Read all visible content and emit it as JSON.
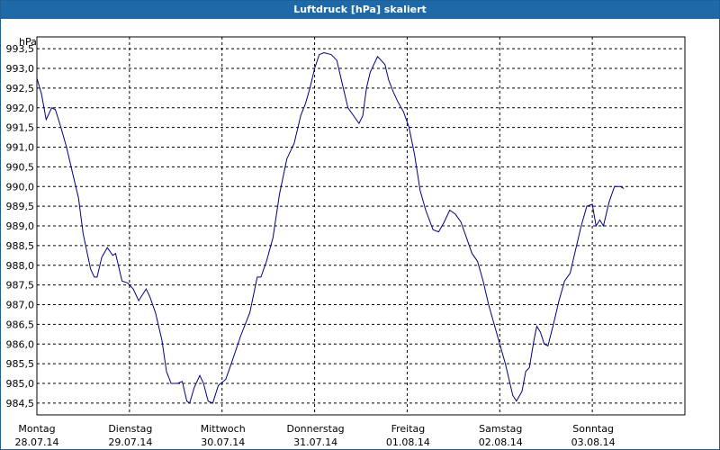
{
  "window": {
    "title": "Luftdruck [hPa] skaliert"
  },
  "chart_data": {
    "type": "line",
    "title": "Luftdruck [hPa] skaliert",
    "ylabel": "hPa",
    "xlim": [
      0,
      7
    ],
    "ylim": [
      984.2,
      993.8
    ],
    "grid": true,
    "line_color": "#000080",
    "y_ticks": [
      "993,5",
      "993,0",
      "992,5",
      "992,0",
      "991,5",
      "991,0",
      "990,5",
      "990,0",
      "989,5",
      "989,0",
      "988,5",
      "988,0",
      "987,5",
      "987,0",
      "986,5",
      "986,0",
      "985,5",
      "985,0",
      "984,5"
    ],
    "y_tick_values": [
      993.5,
      993.0,
      992.5,
      992.0,
      991.5,
      991.0,
      990.5,
      990.0,
      989.5,
      989.0,
      988.5,
      988.0,
      987.5,
      987.0,
      986.5,
      986.0,
      985.5,
      985.0,
      984.5
    ],
    "x_ticks": [
      {
        "day": "Montag",
        "date": "28.07.14"
      },
      {
        "day": "Dienstag",
        "date": "29.07.14"
      },
      {
        "day": "Mittwoch",
        "date": "30.07.14"
      },
      {
        "day": "Donnerstag",
        "date": "31.07.14"
      },
      {
        "day": "Freitag",
        "date": "01.08.14"
      },
      {
        "day": "Samstag",
        "date": "02.08.14"
      },
      {
        "day": "Sonntag",
        "date": "03.08.14"
      }
    ],
    "series": [
      {
        "values": [
          [
            0.0,
            992.75
          ],
          [
            0.05,
            992.35
          ],
          [
            0.1,
            991.7
          ],
          [
            0.16,
            992.0
          ],
          [
            0.2,
            991.95
          ],
          [
            0.26,
            991.5
          ],
          [
            0.32,
            991.0
          ],
          [
            0.4,
            990.2
          ],
          [
            0.45,
            989.7
          ],
          [
            0.5,
            988.8
          ],
          [
            0.58,
            987.9
          ],
          [
            0.62,
            987.7
          ],
          [
            0.65,
            987.7
          ],
          [
            0.7,
            988.2
          ],
          [
            0.76,
            988.45
          ],
          [
            0.82,
            988.25
          ],
          [
            0.85,
            988.3
          ],
          [
            0.92,
            987.6
          ],
          [
            0.98,
            987.55
          ],
          [
            1.04,
            987.4
          ],
          [
            1.1,
            987.1
          ],
          [
            1.18,
            987.4
          ],
          [
            1.22,
            987.2
          ],
          [
            1.28,
            986.8
          ],
          [
            1.35,
            986.1
          ],
          [
            1.4,
            985.3
          ],
          [
            1.45,
            985.0
          ],
          [
            1.52,
            985.0
          ],
          [
            1.57,
            985.05
          ],
          [
            1.62,
            984.55
          ],
          [
            1.65,
            984.5
          ],
          [
            1.7,
            984.9
          ],
          [
            1.76,
            985.2
          ],
          [
            1.8,
            985.0
          ],
          [
            1.85,
            984.55
          ],
          [
            1.9,
            984.5
          ],
          [
            1.96,
            984.95
          ],
          [
            2.04,
            985.1
          ],
          [
            2.1,
            985.5
          ],
          [
            2.2,
            986.2
          ],
          [
            2.3,
            986.8
          ],
          [
            2.38,
            987.7
          ],
          [
            2.42,
            987.7
          ],
          [
            2.48,
            988.1
          ],
          [
            2.55,
            988.7
          ],
          [
            2.62,
            989.8
          ],
          [
            2.7,
            990.7
          ],
          [
            2.78,
            991.1
          ],
          [
            2.85,
            991.8
          ],
          [
            2.9,
            992.1
          ],
          [
            2.95,
            992.5
          ],
          [
            3.0,
            993.0
          ],
          [
            3.05,
            993.35
          ],
          [
            3.1,
            993.4
          ],
          [
            3.18,
            993.35
          ],
          [
            3.24,
            993.2
          ],
          [
            3.3,
            992.6
          ],
          [
            3.36,
            992.0
          ],
          [
            3.42,
            991.8
          ],
          [
            3.48,
            991.6
          ],
          [
            3.52,
            991.8
          ],
          [
            3.56,
            992.5
          ],
          [
            3.6,
            992.9
          ],
          [
            3.65,
            993.15
          ],
          [
            3.68,
            993.3
          ],
          [
            3.72,
            993.2
          ],
          [
            3.76,
            993.1
          ],
          [
            3.8,
            992.7
          ],
          [
            3.85,
            992.4
          ],
          [
            3.9,
            992.15
          ],
          [
            3.96,
            991.9
          ],
          [
            4.02,
            991.5
          ],
          [
            4.08,
            990.8
          ],
          [
            4.14,
            989.9
          ],
          [
            4.2,
            989.4
          ],
          [
            4.28,
            988.9
          ],
          [
            4.34,
            988.85
          ],
          [
            4.4,
            989.1
          ],
          [
            4.46,
            989.4
          ],
          [
            4.52,
            989.3
          ],
          [
            4.58,
            989.1
          ],
          [
            4.64,
            988.7
          ],
          [
            4.7,
            988.3
          ],
          [
            4.76,
            988.1
          ],
          [
            4.82,
            987.6
          ],
          [
            4.88,
            987.0
          ],
          [
            4.94,
            986.5
          ],
          [
            5.0,
            986.0
          ],
          [
            5.06,
            985.5
          ],
          [
            5.1,
            985.1
          ],
          [
            5.14,
            984.7
          ],
          [
            5.18,
            984.55
          ],
          [
            5.24,
            984.8
          ],
          [
            5.28,
            985.3
          ],
          [
            5.32,
            985.4
          ],
          [
            5.37,
            986.1
          ],
          [
            5.4,
            986.45
          ],
          [
            5.44,
            986.3
          ],
          [
            5.48,
            986.0
          ],
          [
            5.52,
            985.95
          ],
          [
            5.58,
            986.5
          ],
          [
            5.64,
            987.1
          ],
          [
            5.7,
            987.6
          ],
          [
            5.76,
            987.8
          ],
          [
            5.82,
            988.4
          ],
          [
            5.88,
            989.0
          ],
          [
            5.94,
            989.5
          ],
          [
            6.0,
            989.55
          ],
          [
            6.04,
            989.0
          ],
          [
            6.08,
            989.15
          ],
          [
            6.12,
            989.0
          ],
          [
            6.18,
            989.6
          ],
          [
            6.24,
            990.0
          ],
          [
            6.3,
            990.0
          ],
          [
            6.34,
            989.95
          ]
        ]
      }
    ]
  }
}
